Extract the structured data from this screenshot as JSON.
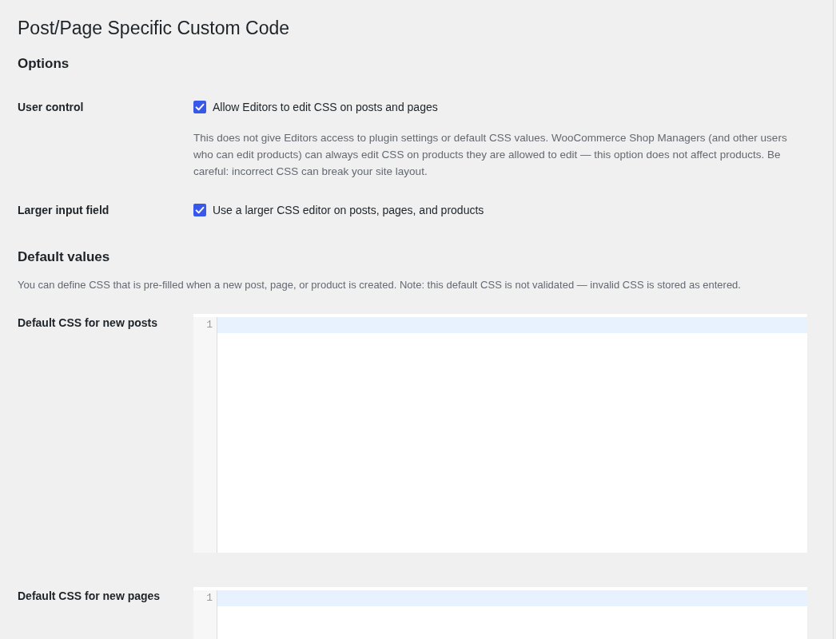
{
  "page": {
    "title": "Post/Page Specific Custom Code"
  },
  "sections": [
    {
      "heading": "Options",
      "rows": [
        {
          "kind": "checkbox",
          "label": "User control",
          "checkbox": {
            "label": "Allow Editors to edit CSS on posts and pages",
            "checked": true
          },
          "description": "This does not give Editors access to plugin settings or default CSS values. WooCommerce Shop Managers (and other users who can edit products) can always edit CSS on products they are allowed to edit — this option does not affect products. Be careful: incorrect CSS can break your site layout."
        },
        {
          "kind": "checkbox",
          "label": "Larger input field",
          "checkbox": {
            "label": "Use a larger CSS editor on posts, pages, and products",
            "checked": true
          }
        }
      ]
    },
    {
      "heading": "Default values",
      "description": "You can define CSS that is pre-filled when a new post, page, or product is created. Note: this default CSS is not validated — invalid CSS is stored as entered.",
      "rows": [
        {
          "kind": "code_editor",
          "label": "Default CSS for new posts",
          "lines": [
            {
              "number": "1",
              "active": true
            }
          ]
        },
        {
          "kind": "code_editor",
          "label": "Default CSS for new pages",
          "lines": [
            {
              "number": "1",
              "active": true
            }
          ]
        }
      ]
    }
  ]
}
